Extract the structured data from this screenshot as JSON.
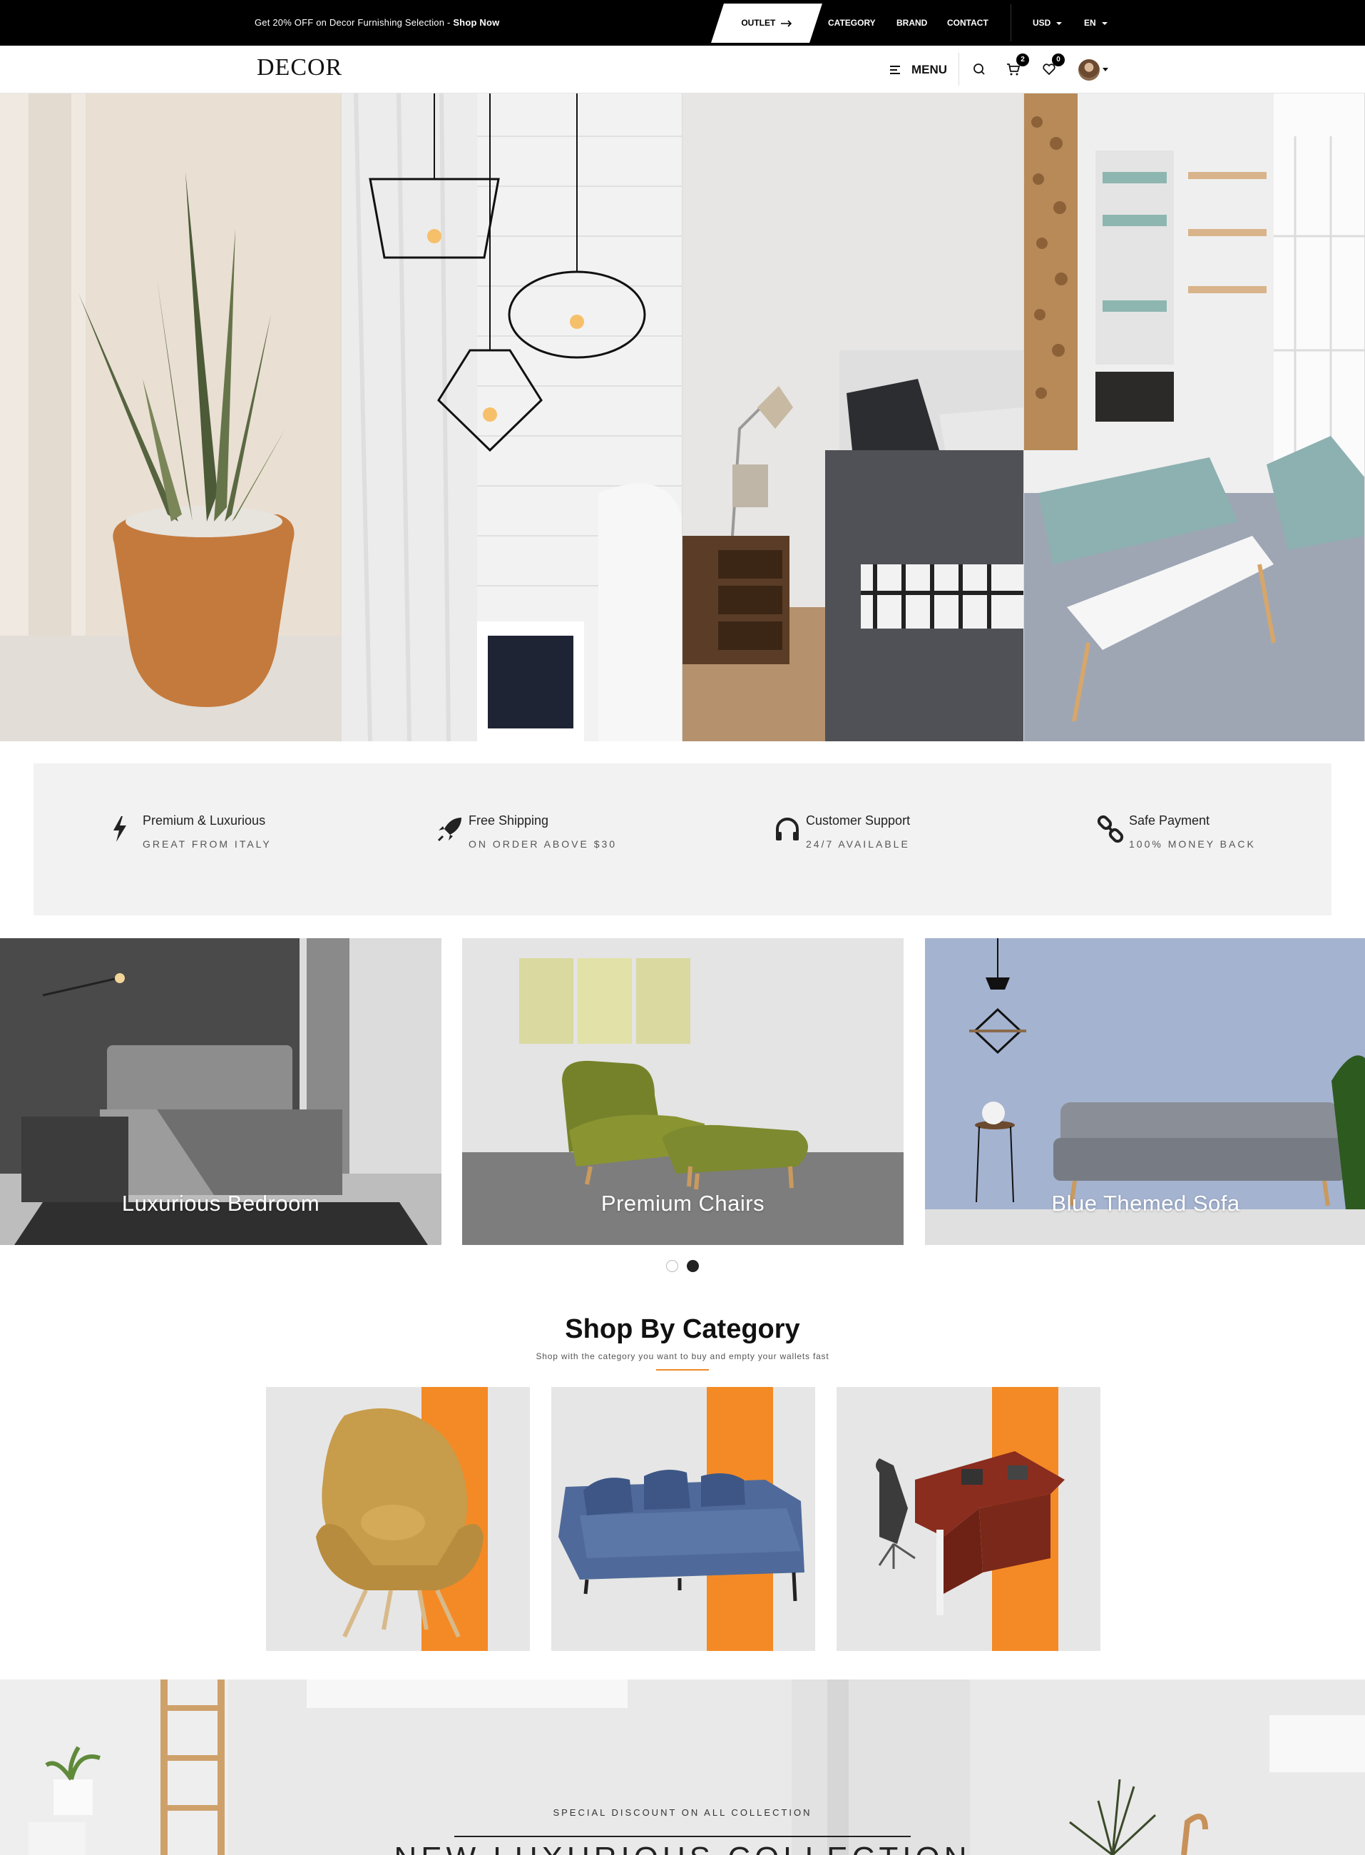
{
  "topbar": {
    "promo_text": "Get 20% OFF on Decor Furnishing Selection - ",
    "promo_link": "Shop Now",
    "outlet_label": "OUTLET",
    "nav": [
      "CATEGORY",
      "BRAND",
      "CONTACT"
    ],
    "currency": "USD",
    "language": "EN"
  },
  "header": {
    "logo": "DECOR",
    "menu_label": "MENU",
    "cart_count": "2",
    "wishlist_count": "0"
  },
  "hero": {
    "panels": [
      "plant-panel",
      "pendant-lamps-panel",
      "bedroom-panel",
      "living-room-panel"
    ]
  },
  "features": [
    {
      "icon": "lightning-icon",
      "title": "Premium & Luxurious",
      "subtitle": "GREAT FROM ITALY"
    },
    {
      "icon": "rocket-icon",
      "title": "Free Shipping",
      "subtitle": "ON ORDER ABOVE $30"
    },
    {
      "icon": "headphones-icon",
      "title": "Customer Support",
      "subtitle": "24/7 AVAILABLE"
    },
    {
      "icon": "chain-link-icon",
      "title": "Safe Payment",
      "subtitle": "100% MONEY BACK"
    }
  ],
  "collections": [
    {
      "title": "Luxurious Bedroom"
    },
    {
      "title": "Premium Chairs"
    },
    {
      "title": "Blue Themed Sofa"
    }
  ],
  "carousel": {
    "pages": 2,
    "active": 2
  },
  "shop_by_category": {
    "title": "Shop By Category",
    "subtitle": "Shop with the category you want to buy and empty your wallets fast",
    "categories": [
      "armchair",
      "sofa",
      "office-desk"
    ]
  },
  "banner": {
    "subtitle": "SPECIAL DISCOUNT ON ALL COLLECTION",
    "title": "NEW LUXURIOUS COLLECTION"
  },
  "colors": {
    "accent": "#f48a25",
    "topbar_bg": "#000000",
    "feature_bg": "#f2f2f2"
  }
}
